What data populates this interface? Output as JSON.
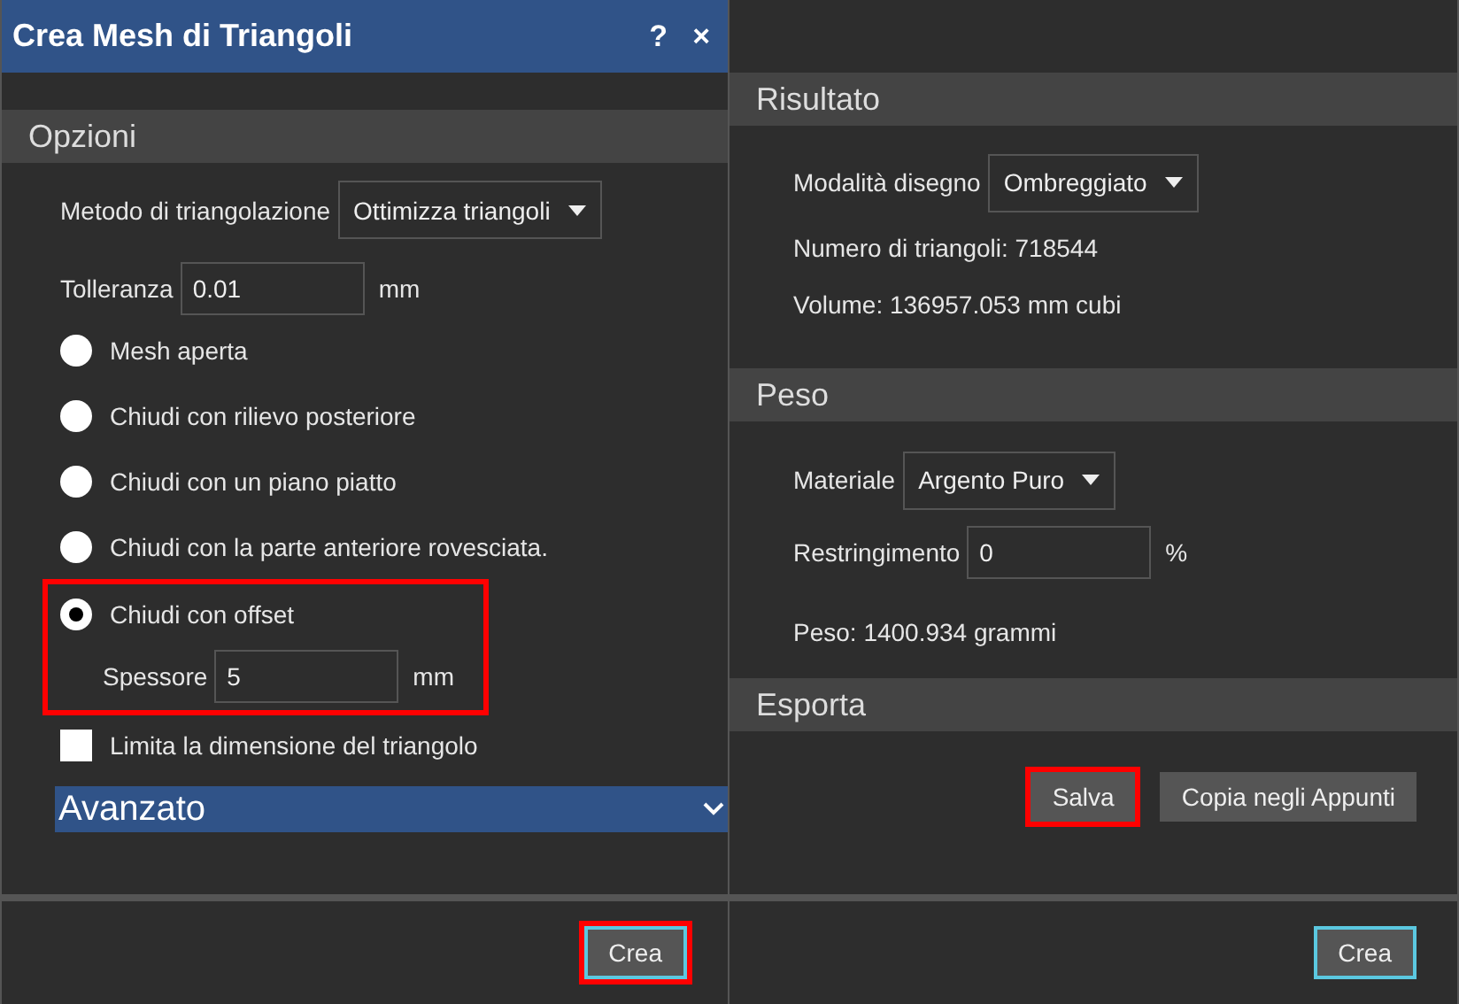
{
  "window": {
    "title": "Crea Mesh di Triangoli",
    "help": "?",
    "close": "×"
  },
  "options": {
    "title": "Opzioni",
    "method": {
      "label": "Metodo di triangolazione",
      "value": "Ottimizza triangoli"
    },
    "tolerance": {
      "label": "Tolleranza",
      "value": "0.01",
      "unit": "mm"
    },
    "radios": [
      {
        "label": "Mesh aperta",
        "selected": false,
        "highlighted": false
      },
      {
        "label": "Chiudi con rilievo posteriore",
        "selected": false,
        "highlighted": false
      },
      {
        "label": "Chiudi con un piano piatto",
        "selected": false,
        "highlighted": false
      },
      {
        "label": "Chiudi con la parte anteriore rovesciata.",
        "selected": false,
        "highlighted": false
      },
      {
        "label": "Chiudi con offset",
        "selected": true,
        "highlighted": true,
        "sub_field": {
          "label": "Spessore",
          "value": "5",
          "unit": "mm"
        }
      }
    ],
    "limit": {
      "label": "Limita la dimensione del triangolo",
      "checked": false
    },
    "advanced": {
      "label": "Avanzato",
      "expanded": false
    }
  },
  "left_footer": {
    "button": {
      "label": "Crea",
      "highlighted": true
    }
  },
  "result": {
    "title": "Risultato",
    "mode": {
      "label": "Modalità disegno",
      "value": "Ombreggiato"
    },
    "lines": [
      "Numero di triangoli: 718544",
      "Volume: 136957.053 mm cubi"
    ]
  },
  "weight": {
    "title": "Peso",
    "material": {
      "label": "Materiale",
      "value": "Argento Puro"
    },
    "shrink": {
      "label": "Restringimento",
      "value": "0",
      "unit": "%"
    },
    "line": "Peso: 1400.934 grammi"
  },
  "export": {
    "title": "Esporta",
    "buttons": [
      {
        "label": "Salva",
        "highlighted": true
      },
      {
        "label": "Copia negli Appunti",
        "highlighted": false
      }
    ]
  },
  "right_footer": {
    "button": {
      "label": "Crea",
      "highlighted": false
    }
  }
}
